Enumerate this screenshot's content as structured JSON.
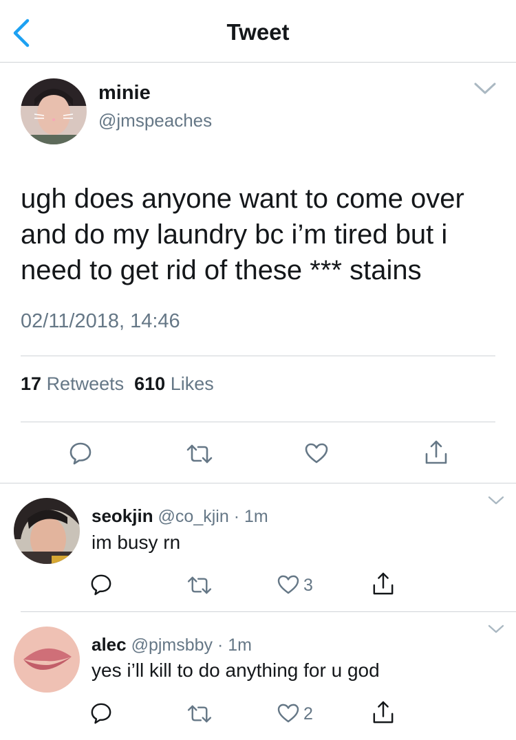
{
  "header": {
    "title": "Tweet"
  },
  "tweet": {
    "author": {
      "name": "minie",
      "handle": "@jmspeaches"
    },
    "text": "ugh does anyone want to come over and do my laundry bc i’m tired but i need to get rid of these *** stains",
    "timestamp": "02/11/2018, 14:46",
    "stats": {
      "retweets_count": "17",
      "retweets_label": "Retweets",
      "likes_count": "610",
      "likes_label": "Likes"
    }
  },
  "replies": [
    {
      "name": "seokjin",
      "handle": "@co_kjin",
      "time": "1m",
      "text": "im busy rn",
      "like_count": "3"
    },
    {
      "name": "alec",
      "handle": "@pjmsbby",
      "time": "1m",
      "text": "yes i’ll kill to do anything for u god",
      "like_count": "2"
    }
  ],
  "separator": "·",
  "colors": {
    "accent": "#1da1f2",
    "secondary_text": "#657786",
    "primary_text": "#14171a",
    "divider": "#cfd3d7"
  },
  "icons": [
    "back-chevron-icon",
    "chevron-down-icon",
    "reply-icon",
    "retweet-icon",
    "like-icon",
    "share-icon"
  ]
}
